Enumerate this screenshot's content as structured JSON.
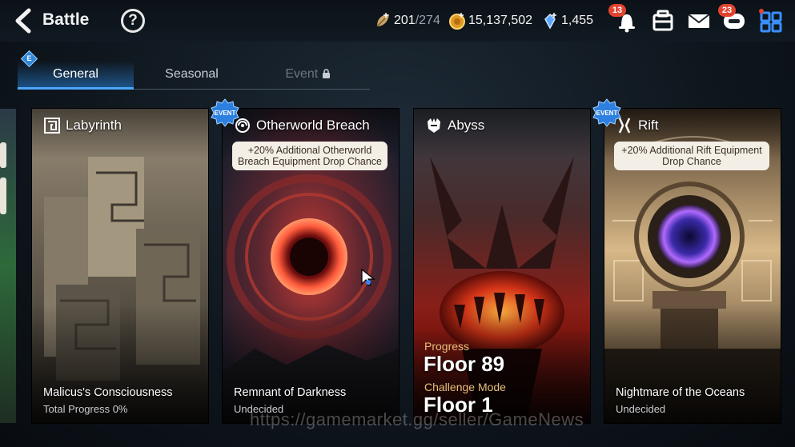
{
  "header": {
    "title": "Battle",
    "stamina": {
      "current": "201",
      "max": "/274"
    },
    "gold": "15,137,502",
    "skystones": "1,455",
    "notifications_badge": "13",
    "chat_badge": "23"
  },
  "tabs": {
    "new_badge": "E",
    "items": [
      {
        "label": "General"
      },
      {
        "label": "Seasonal"
      },
      {
        "label": "Event"
      }
    ]
  },
  "cards": {
    "labyrinth": {
      "title": "Labyrinth",
      "stage": "Malicus's Consciousness",
      "sub": "Total Progress 0%"
    },
    "otherworld": {
      "title": "Otherworld Breach",
      "event": "EVENT",
      "bonus": "+20% Additional Otherworld Breach Equipment Drop Chance",
      "stage": "Remnant of Darkness",
      "sub": "Undecided"
    },
    "abyss": {
      "title": "Abyss",
      "progress_label": "Progress",
      "progress_floor": "Floor 89",
      "challenge_label": "Challenge Mode",
      "challenge_floor": "Floor 1"
    },
    "rift": {
      "title": "Rift",
      "event": "EVENT",
      "bonus": "+20% Additional Rift Equipment Drop Chance",
      "stage": "Nightmare of the Oceans",
      "sub": "Undecided"
    }
  },
  "watermark": "https://gamemarket.gg/seller/GameNews",
  "colors": {
    "accent": "#4aa8ff",
    "badge": "#e2432f",
    "gold_text": "#e6c07a",
    "bonus_bg": "#f4efe6"
  }
}
